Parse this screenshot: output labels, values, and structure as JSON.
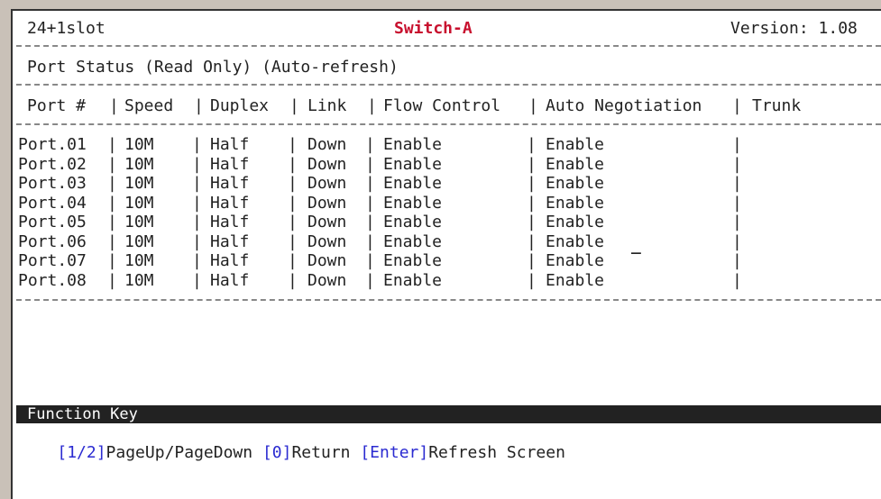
{
  "header": {
    "left": "24+1slot",
    "center": "Switch-A",
    "right": "Version: 1.08"
  },
  "subtitle": "Port Status (Read Only) (Auto-refresh)",
  "table": {
    "columns": [
      "Port #",
      "Speed",
      "Duplex",
      "Link",
      "Flow Control",
      "Auto Negotiation",
      "Trunk"
    ],
    "rows": [
      [
        "Port.01",
        "10M",
        "Half",
        "Down",
        "Enable",
        "Enable",
        ""
      ],
      [
        "Port.02",
        "10M",
        "Half",
        "Down",
        "Enable",
        "Enable",
        ""
      ],
      [
        "Port.03",
        "10M",
        "Half",
        "Down",
        "Enable",
        "Enable",
        ""
      ],
      [
        "Port.04",
        "10M",
        "Half",
        "Down",
        "Enable",
        "Enable",
        ""
      ],
      [
        "Port.05",
        "10M",
        "Half",
        "Down",
        "Enable",
        "Enable",
        ""
      ],
      [
        "Port.06",
        "10M",
        "Half",
        "Down",
        "Enable",
        "Enable",
        ""
      ],
      [
        "Port.07",
        "10M",
        "Half",
        "Down",
        "Enable",
        "Enable",
        ""
      ],
      [
        "Port.08",
        "10M",
        "Half",
        "Down",
        "Enable",
        "Enable",
        ""
      ]
    ]
  },
  "cursor": "_",
  "function_key": {
    "title": "Function Key",
    "keys": [
      {
        "key": "[1/2]",
        "action": "PageUp/PageDown"
      },
      {
        "key": "[0]",
        "action": "Return"
      },
      {
        "key": "[Enter]",
        "action": "Refresh Screen"
      }
    ]
  }
}
